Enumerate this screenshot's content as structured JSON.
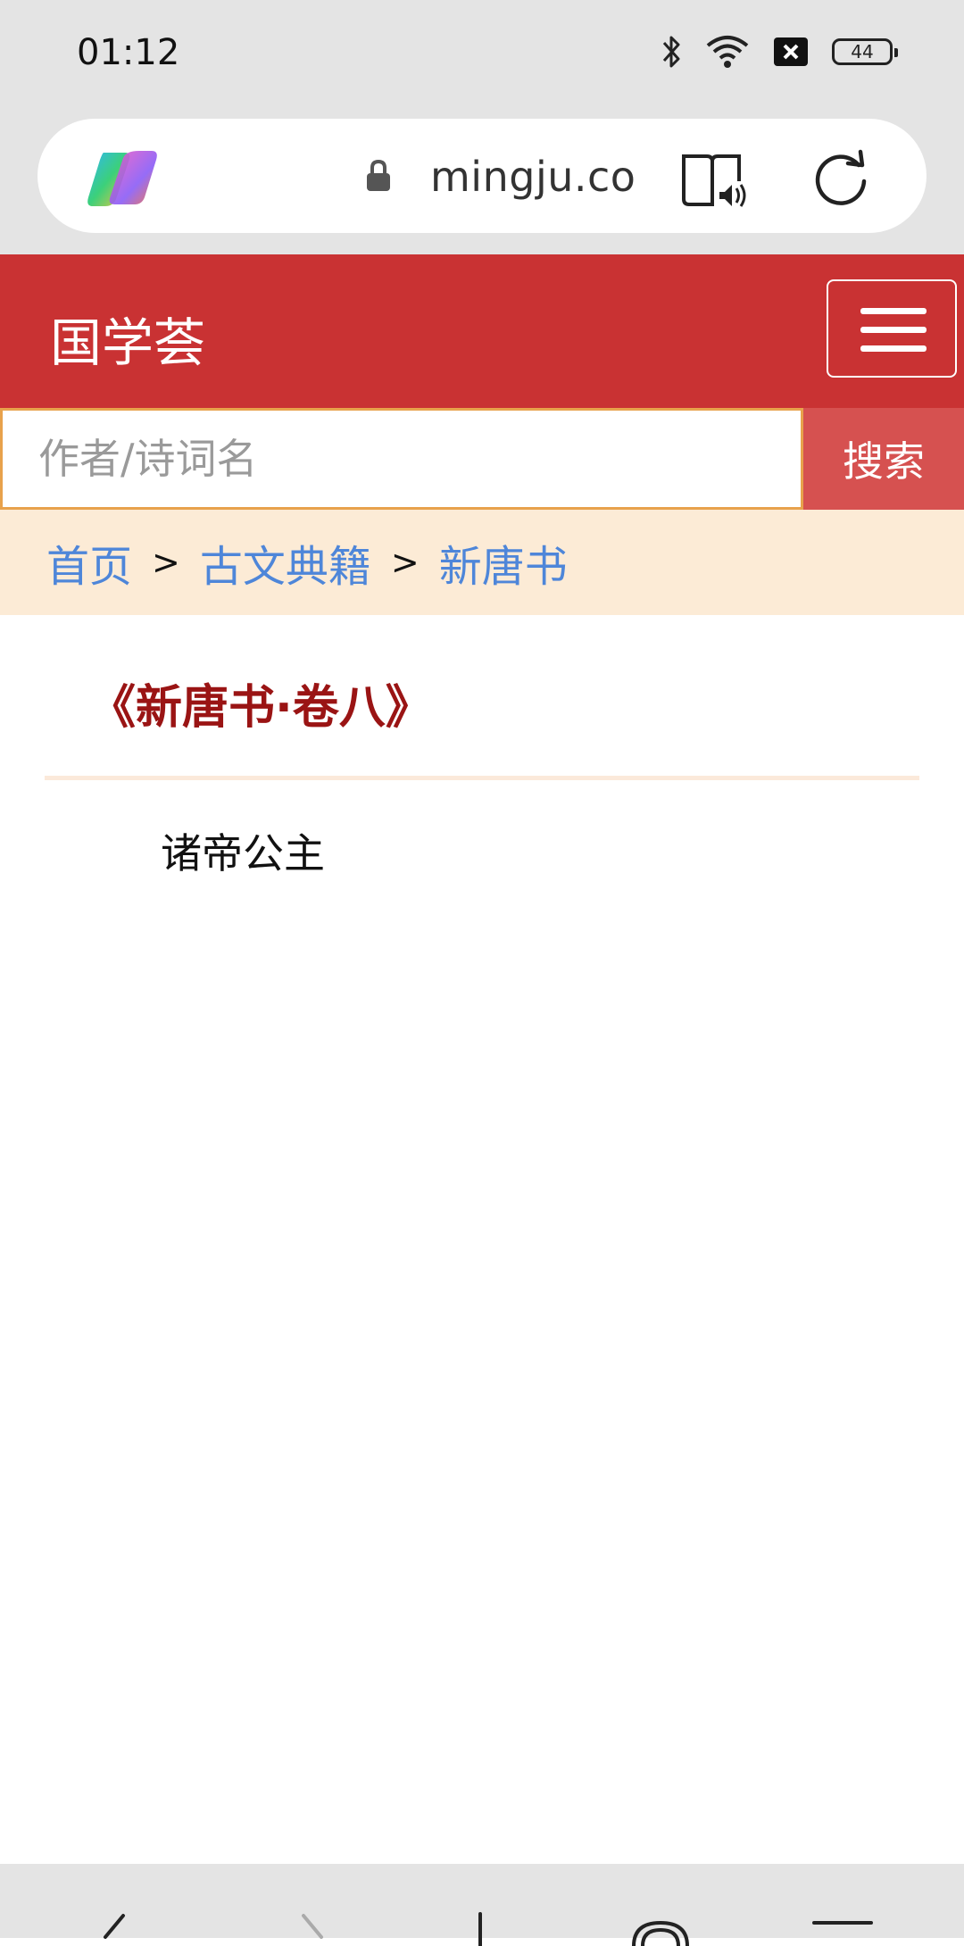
{
  "status_bar": {
    "time": "01:12",
    "battery_level": "44",
    "icons": [
      "bluetooth-icon",
      "wifi-icon",
      "notification-x-icon",
      "battery-icon"
    ]
  },
  "browser": {
    "url": "mingju.co",
    "icons": [
      "copilot-icon",
      "lock-icon",
      "read-aloud-icon",
      "reload-icon"
    ]
  },
  "header": {
    "site_title": "国学荟",
    "menu_icon": "hamburger-menu-icon"
  },
  "search": {
    "placeholder": "作者/诗词名",
    "value": "",
    "button_label": "搜索"
  },
  "breadcrumb": {
    "items": [
      "首页",
      "古文典籍",
      "新唐书"
    ],
    "separator": ">"
  },
  "content": {
    "book_title": "《新唐书·卷八》",
    "chapters": [
      "诸帝公主"
    ]
  },
  "bottom_nav": {
    "icons": [
      "back-icon",
      "forward-icon",
      "new-tab-icon",
      "tabs-icon",
      "menu-icon"
    ]
  },
  "colors": {
    "header_red": "#c93233",
    "search_button": "#d65150",
    "breadcrumb_bg": "#fcebd6",
    "link_blue": "#4e86d9",
    "title_red": "#9a1414",
    "search_border": "#e8a24c"
  }
}
